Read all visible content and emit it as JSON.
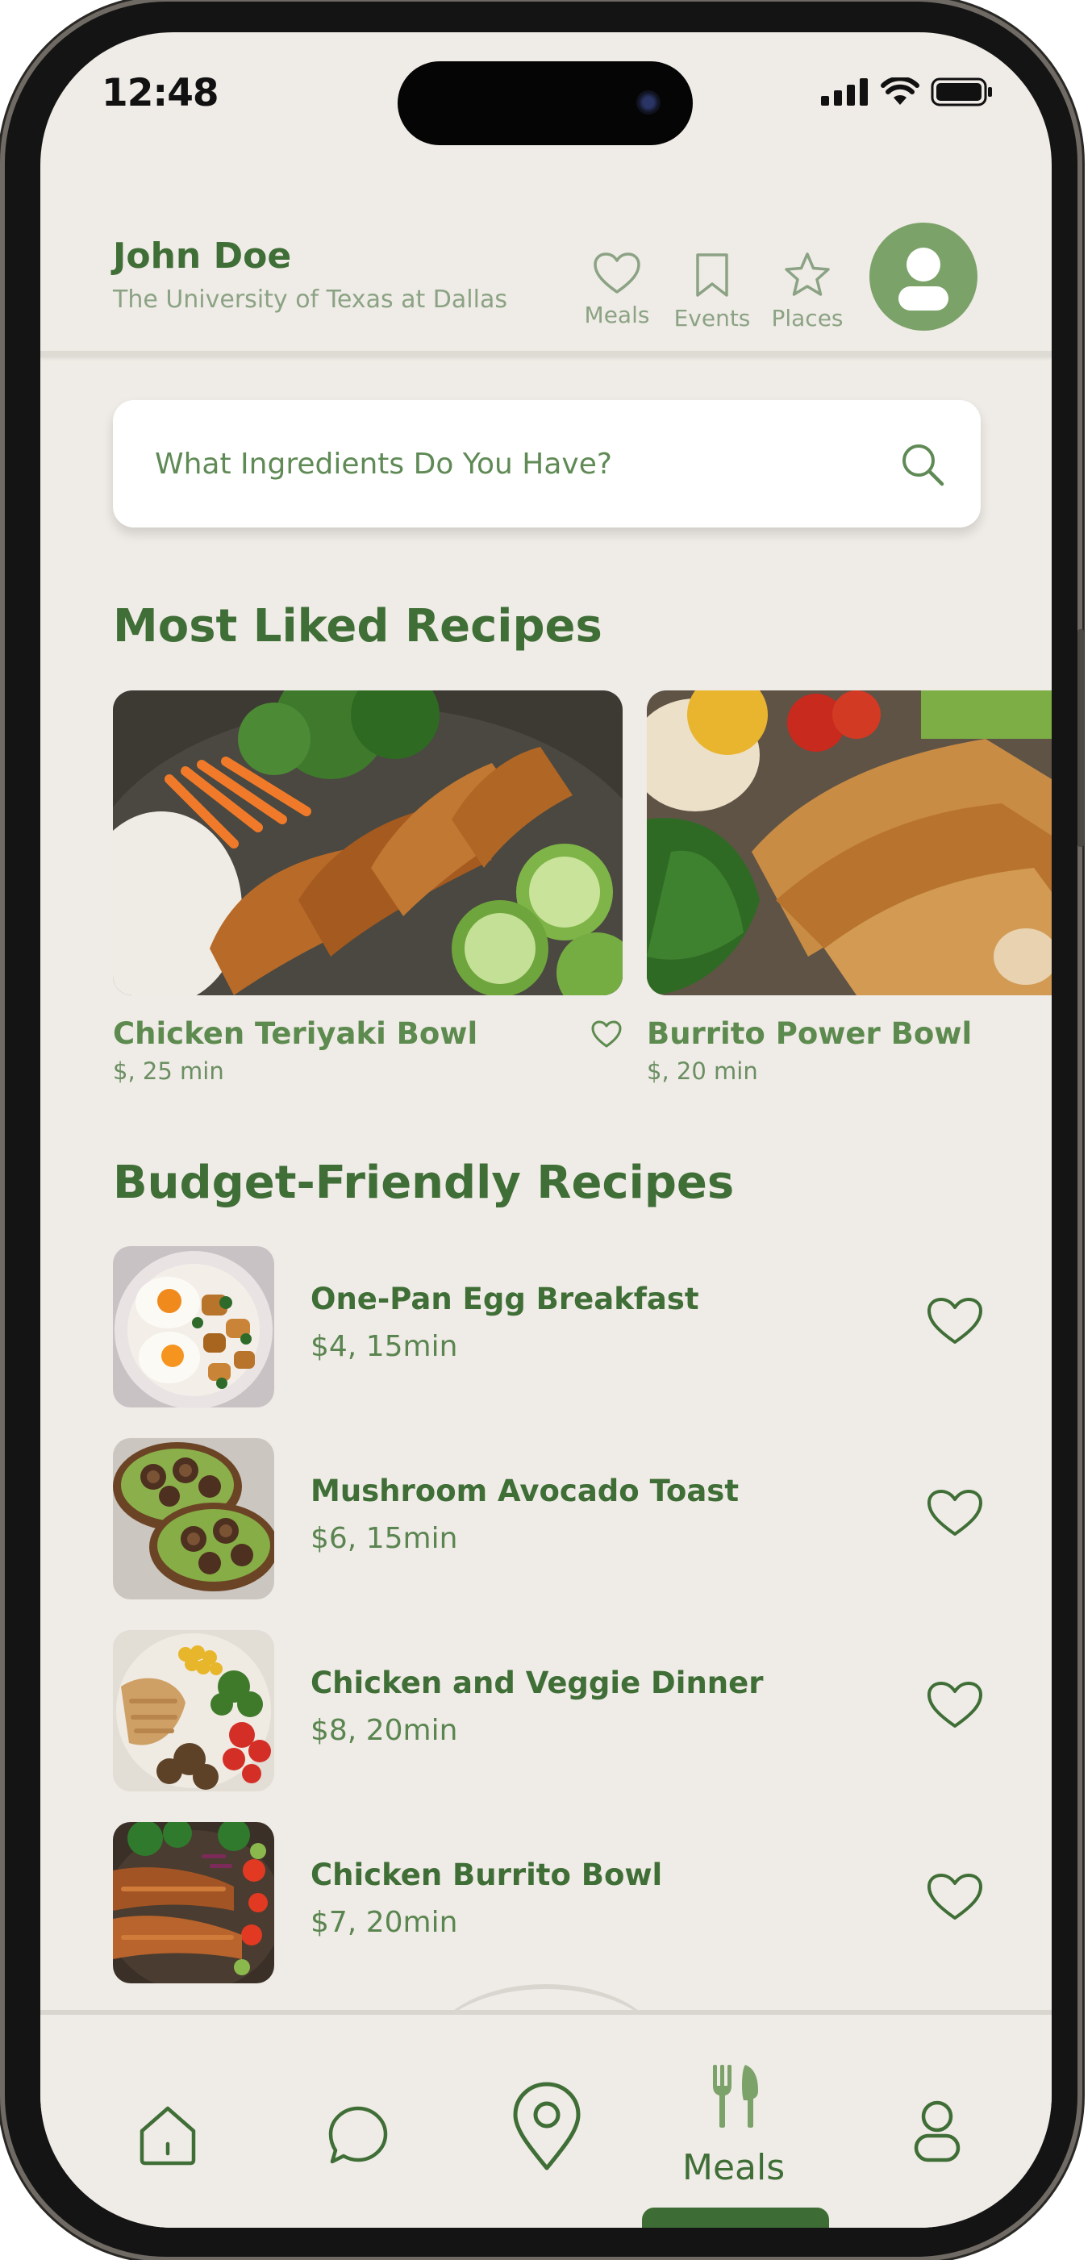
{
  "status": {
    "time": "12:48"
  },
  "header": {
    "user_name": "John Doe",
    "school": "The University of Texas at Dallas",
    "nav": [
      {
        "label": "Meals",
        "icon": "heart-icon"
      },
      {
        "label": "Events",
        "icon": "bookmark-icon"
      },
      {
        "label": "Places",
        "icon": "star-icon"
      }
    ],
    "avatar_icon": "user-icon"
  },
  "search": {
    "placeholder": "What Ingredients Do You Have?"
  },
  "most_liked": {
    "title": "Most Liked Recipes",
    "cards": [
      {
        "title": "Chicken Teriyaki Bowl",
        "meta": "$, 25 min"
      },
      {
        "title": "Burrito Power Bowl",
        "meta": "$, 20 min"
      }
    ]
  },
  "budget": {
    "title": "Budget-Friendly Recipes",
    "items": [
      {
        "title": "One-Pan Egg Breakfast",
        "meta": "$4, 15min"
      },
      {
        "title": "Mushroom Avocado Toast",
        "meta": "$6, 15min"
      },
      {
        "title": "Chicken and Veggie Dinner",
        "meta": "$8, 20min"
      },
      {
        "title": "Chicken Burrito Bowl",
        "meta": "$7, 20min"
      }
    ]
  },
  "bottom_nav": {
    "items": [
      "home-icon",
      "chat-icon",
      "map-pin-icon",
      "fork-knife-icon",
      "profile-icon"
    ],
    "active_label": "Meals"
  },
  "colors": {
    "accent": "#3f6e36",
    "light_accent": "#7ba269",
    "background": "#efebe6"
  }
}
